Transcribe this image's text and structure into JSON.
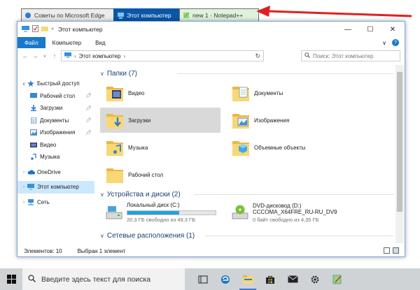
{
  "browser_tabs": [
    {
      "label": "Советы по Microsoft Edge"
    },
    {
      "label": "Этот компьютер"
    },
    {
      "label": "new  1 - Notepad++"
    }
  ],
  "window": {
    "title": "Этот компьютер",
    "controls": {
      "minimize": "—",
      "maximize": "☐",
      "close": "✕"
    }
  },
  "ribbon": {
    "tabs": [
      "Файл",
      "Компьютер",
      "Вид"
    ],
    "expand": "∨",
    "help": "?"
  },
  "address": {
    "path": "Этот компьютер",
    "search_placeholder": "Поиск: Этот компьютер"
  },
  "nav_pane": {
    "items": [
      {
        "label": "Быстрый доступ",
        "icon": "star-icon"
      },
      {
        "label": "Рабочий стол",
        "icon": "desktop-icon"
      },
      {
        "label": "Загрузки",
        "icon": "download-icon"
      },
      {
        "label": "Документы",
        "icon": "document-icon"
      },
      {
        "label": "Изображения",
        "icon": "image-icon"
      },
      {
        "label": "Видео",
        "icon": "video-icon"
      },
      {
        "label": "Музыка",
        "icon": "music-icon"
      },
      {
        "label": "OneDrive",
        "icon": "cloud-icon"
      },
      {
        "label": "Этот компьютер",
        "icon": "computer-icon"
      },
      {
        "label": "Сеть",
        "icon": "network-icon"
      }
    ]
  },
  "content": {
    "folders_header": "Папки (7)",
    "folders": [
      {
        "label": "Видео"
      },
      {
        "label": "Документы"
      },
      {
        "label": "Загрузки"
      },
      {
        "label": "Изображения"
      },
      {
        "label": "Музыка"
      },
      {
        "label": "Объемные объекты"
      },
      {
        "label": "Рабочий стол"
      }
    ],
    "devices_header": "Устройства и диски (2)",
    "drives": [
      {
        "name": "Локальный диск (C:)",
        "free": "20,3 ГБ свободно из 49,3 ГБ",
        "used_fraction": 0.59
      },
      {
        "name": "DVD-дисковод (D:)",
        "volume": "CCCOMA_X64FRE_RU-RU_DV9",
        "free": "0 байт свободно из 4,35 ГБ"
      }
    ],
    "network_header": "Сетевые расположения (1)"
  },
  "status": {
    "count": "Элементов: 10",
    "selected": "Выбран 1 элемент"
  },
  "taskbar": {
    "search_placeholder": "Введите здесь текст для поиска"
  },
  "colors": {
    "accent": "#1979ca",
    "arrow": "#e02020",
    "selected_nav": "#cce8ff",
    "folder": "#f8d775"
  }
}
